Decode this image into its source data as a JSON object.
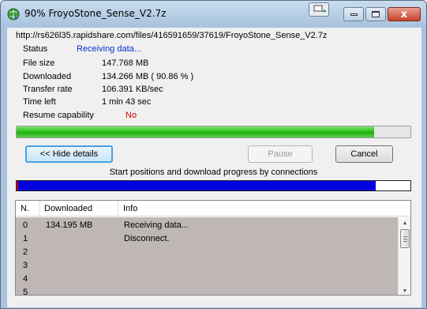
{
  "window": {
    "title": "90% FroyoStone_Sense_V2.7z",
    "close_label": "x"
  },
  "info": {
    "url": "http://rs626l35.rapidshare.com/files/416591659/37619/FroyoStone_Sense_V2.7z",
    "status_label": "Status",
    "status_value": "Receiving data...",
    "rows": [
      {
        "label": "File size",
        "value": "147.768  MB"
      },
      {
        "label": "Downloaded",
        "value": "134.266  MB  ( 90.86 % )"
      },
      {
        "label": "Transfer rate",
        "value": "106.391  KB/sec"
      },
      {
        "label": "Time left",
        "value": "1 min 43 sec"
      }
    ],
    "resume_label": "Resume capability",
    "resume_value": "No"
  },
  "progress": {
    "percent": 90.86
  },
  "buttons": {
    "hide_details": "<< Hide details",
    "pause": "Pause",
    "cancel": "Cancel"
  },
  "connections": {
    "caption": "Start positions and download progress by connections",
    "fill_fraction": 0.908,
    "colors": {
      "progress": "#0000e0",
      "start_marker": "#cc0000"
    }
  },
  "table": {
    "headers": {
      "n": "N.",
      "downloaded": "Downloaded",
      "info": "Info"
    },
    "rows": [
      {
        "n": "0",
        "downloaded": "134.195  MB",
        "info": "Receiving data..."
      },
      {
        "n": "1",
        "downloaded": "",
        "info": "Disconnect."
      },
      {
        "n": "2",
        "downloaded": "",
        "info": ""
      },
      {
        "n": "3",
        "downloaded": "",
        "info": ""
      },
      {
        "n": "4",
        "downloaded": "",
        "info": ""
      },
      {
        "n": "5",
        "downloaded": "",
        "info": ""
      }
    ]
  },
  "icons": {
    "app": "globe-download-icon",
    "minimize": "minimize-icon",
    "maximize": "maximize-icon",
    "close": "close-icon",
    "scroll_up": "scroll-up-icon",
    "scroll_down": "scroll-down-icon"
  }
}
